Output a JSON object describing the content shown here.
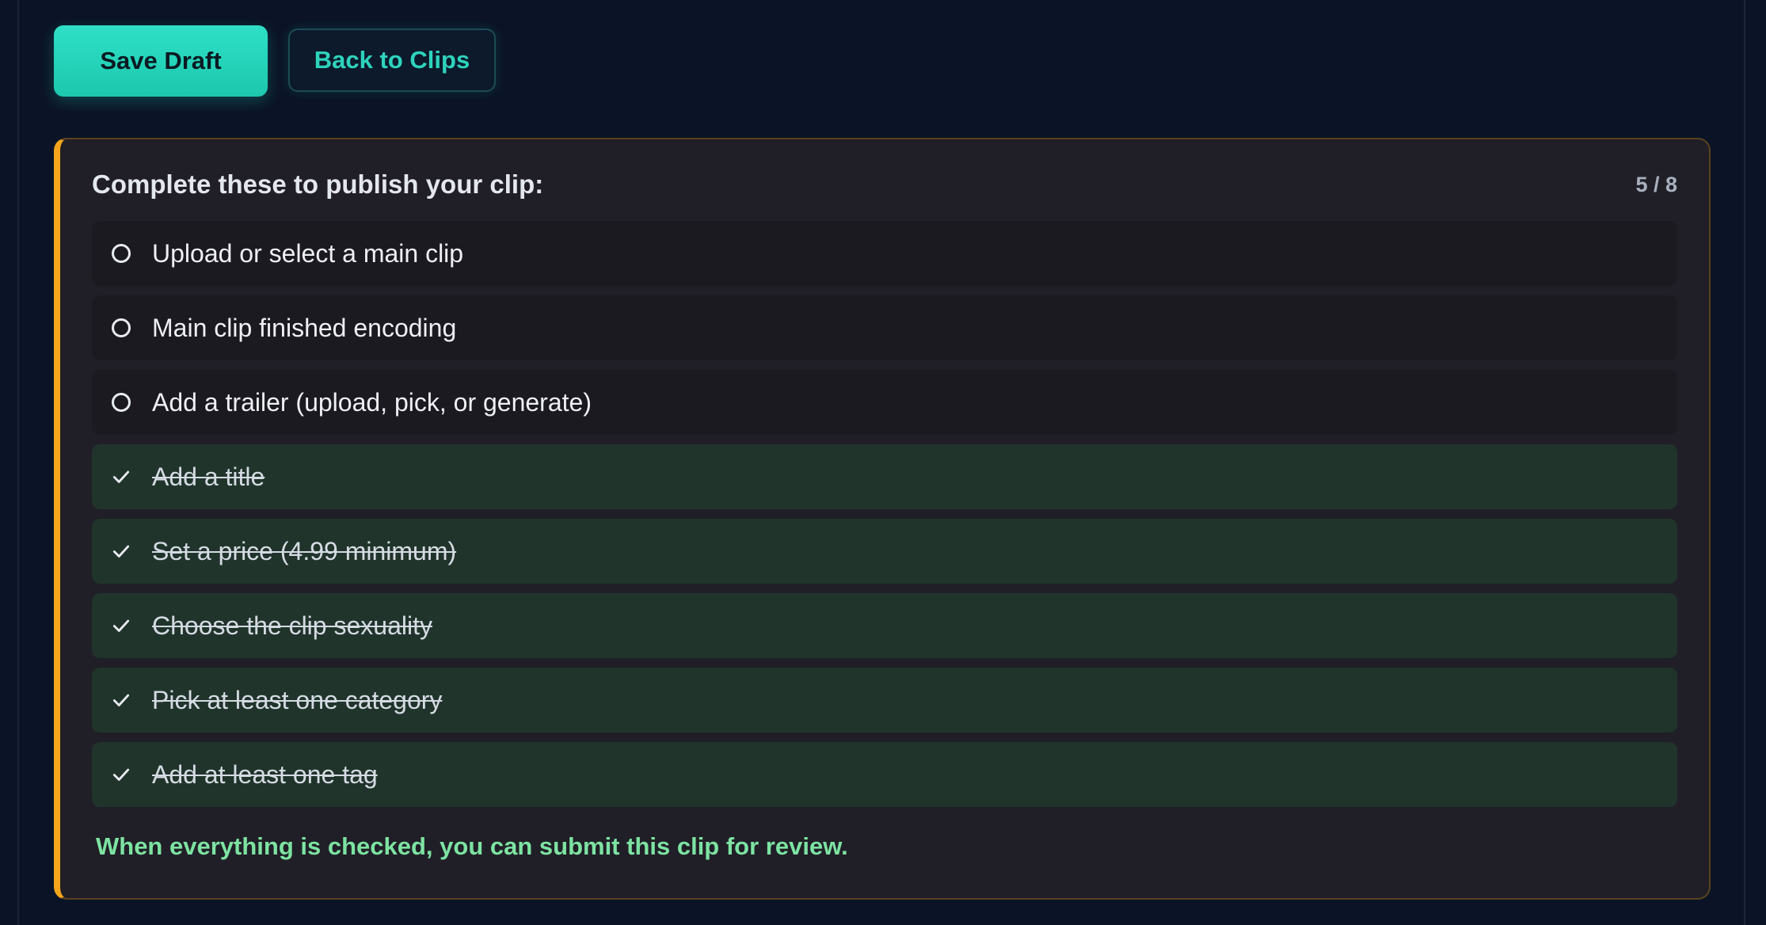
{
  "toolbar": {
    "save_label": "Save Draft",
    "back_label": "Back to Clips"
  },
  "checklist": {
    "title": "Complete these to publish your clip:",
    "progress": "5 / 8",
    "items": [
      {
        "label": "Upload or select a main clip",
        "done": false
      },
      {
        "label": "Main clip finished encoding",
        "done": false
      },
      {
        "label": "Add a trailer (upload, pick, or generate)",
        "done": false
      },
      {
        "label": "Add a title",
        "done": true
      },
      {
        "label": "Set a price (4.99 minimum)",
        "done": true
      },
      {
        "label": "Choose the clip sexuality",
        "done": true
      },
      {
        "label": "Pick at least one category",
        "done": true
      },
      {
        "label": "Add at least one tag",
        "done": true
      }
    ],
    "footer": "When everything is checked, you can submit this clip for review."
  },
  "colors": {
    "accent": "#23d2b8",
    "warning_border": "#f4a51c",
    "success_text": "#7de3a2",
    "done_row": "#20342b"
  },
  "icons": {
    "pending": "circle-icon",
    "done": "check-icon"
  }
}
